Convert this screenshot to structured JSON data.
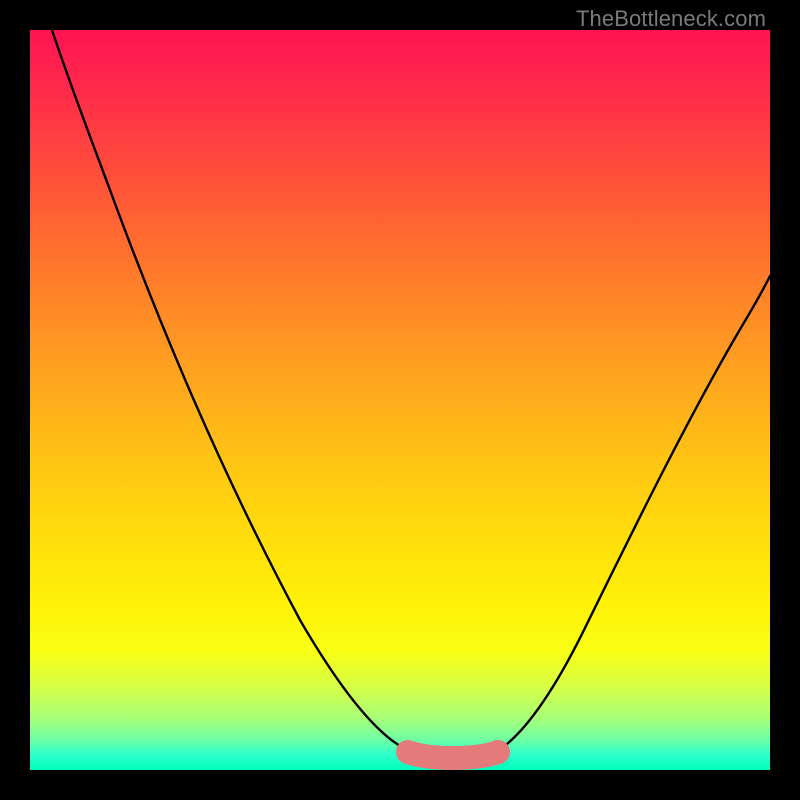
{
  "watermark": "TheBottleneck.com",
  "chart_data": {
    "type": "line",
    "title": "",
    "xlabel": "",
    "ylabel": "",
    "xlim": [
      0,
      100
    ],
    "ylim": [
      0,
      100
    ],
    "series": [
      {
        "name": "bottleneck-curve-left",
        "x": [
          3,
          8,
          14,
          20,
          27,
          34,
          41,
          48,
          52
        ],
        "values": [
          100,
          88,
          76,
          64,
          51,
          38,
          25,
          12,
          4
        ]
      },
      {
        "name": "bottleneck-curve-right",
        "x": [
          63,
          67,
          72,
          78,
          84,
          90,
          95,
          100
        ],
        "values": [
          4,
          11,
          21,
          32,
          42,
          52,
          60,
          68
        ]
      }
    ],
    "annotations": [
      {
        "name": "optimal-band",
        "type": "segment",
        "x": [
          51,
          63
        ],
        "values": [
          2.5,
          2.5
        ],
        "color": "#e47a7a",
        "width_pct": 3.2
      }
    ],
    "background": {
      "type": "vertical-gradient",
      "stops": [
        {
          "pct": 0,
          "color": "#ff1452"
        },
        {
          "pct": 50,
          "color": "#ffb018"
        },
        {
          "pct": 80,
          "color": "#fff208"
        },
        {
          "pct": 100,
          "color": "#00ffbb"
        }
      ]
    }
  }
}
